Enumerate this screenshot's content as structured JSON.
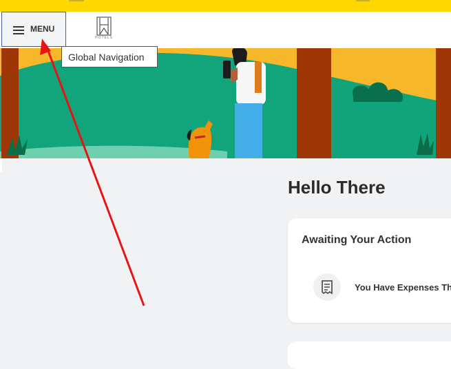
{
  "header": {
    "menu_label": "MENU",
    "logo_text": "HOTELS"
  },
  "tooltip": {
    "text": "Global Navigation"
  },
  "main": {
    "greeting": "Hello There"
  },
  "awaiting_card": {
    "title": "Awaiting Your Action",
    "item_text": "You Have Expenses Tha"
  },
  "colors": {
    "topbar": "#ffd800",
    "menu_border": "#3a5f96",
    "arrow": "#e81313"
  },
  "icons": {
    "menu": "hamburger-icon",
    "card_item": "receipt-icon"
  }
}
